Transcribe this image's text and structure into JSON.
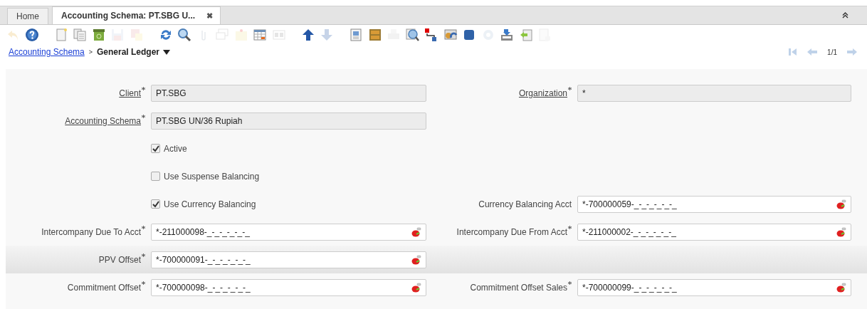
{
  "tabs": [
    {
      "label": "Home",
      "selected": false
    },
    {
      "label": "Accounting Schema: PT.SBG U...",
      "selected": true,
      "close_label": "✖"
    }
  ],
  "toolbar_groups": [
    {
      "buttons": [
        {
          "kind": "undo",
          "disabled": true
        },
        {
          "kind": "help",
          "disabled": false
        }
      ]
    },
    {
      "buttons": [
        {
          "kind": "new",
          "disabled": false
        },
        {
          "kind": "copy",
          "disabled": false
        },
        {
          "kind": "delete",
          "disabled": false
        },
        {
          "kind": "save",
          "disabled": true
        },
        {
          "kind": "savenew",
          "disabled": true
        }
      ]
    },
    {
      "buttons": [
        {
          "kind": "refresh",
          "disabled": false
        },
        {
          "kind": "find",
          "disabled": false
        },
        {
          "kind": "attach",
          "disabled": true
        },
        {
          "kind": "chat",
          "disabled": true
        },
        {
          "kind": "note",
          "disabled": true
        },
        {
          "kind": "grid",
          "disabled": false
        },
        {
          "kind": "multi",
          "disabled": true
        }
      ]
    },
    {
      "buttons": [
        {
          "kind": "up",
          "disabled": false
        },
        {
          "kind": "down",
          "disabled": true
        }
      ]
    },
    {
      "buttons": [
        {
          "kind": "report",
          "disabled": false
        },
        {
          "kind": "archive",
          "disabled": false
        },
        {
          "kind": "print",
          "disabled": true
        },
        {
          "kind": "zoom",
          "disabled": false
        },
        {
          "kind": "export",
          "disabled": false
        },
        {
          "kind": "request",
          "disabled": false
        },
        {
          "kind": "product",
          "disabled": false
        },
        {
          "kind": "process",
          "disabled": true
        },
        {
          "kind": "import",
          "disabled": false
        },
        {
          "kind": "back",
          "disabled": false
        },
        {
          "kind": "custom",
          "disabled": true
        }
      ]
    }
  ],
  "breadcrumb": {
    "link": "Accounting Schema",
    "separator": ">",
    "current": "General Ledger"
  },
  "navigation": {
    "record": "1/1",
    "first_disabled": true,
    "prev_disabled": true,
    "next_disabled": true
  },
  "rows": [
    {
      "highlighted": false,
      "left": {
        "kind": "field",
        "label": "Client",
        "required": true,
        "linked": true,
        "readonly": true,
        "value": "PT.SBG",
        "lookup": false
      },
      "right": {
        "kind": "field",
        "label": "Organization",
        "required": true,
        "linked": true,
        "readonly": true,
        "value": "*",
        "lookup": false
      }
    },
    {
      "highlighted": false,
      "left": {
        "kind": "field",
        "label": "Accounting Schema",
        "required": true,
        "linked": true,
        "readonly": true,
        "value": "PT.SBG UN/36 Rupiah",
        "lookup": false
      }
    },
    {
      "highlighted": false,
      "left": {
        "kind": "checkbox",
        "label": "Active",
        "checked": true
      }
    },
    {
      "highlighted": false,
      "left": {
        "kind": "checkbox",
        "label": "Use Suspense Balancing",
        "checked": false
      }
    },
    {
      "highlighted": false,
      "left": {
        "kind": "checkbox",
        "label": "Use Currency Balancing",
        "checked": true
      },
      "right": {
        "kind": "field",
        "label": "Currency Balancing Acct",
        "required": false,
        "linked": false,
        "readonly": false,
        "value": "*-700000059-_-_-_-_-_-_",
        "lookup": true
      }
    },
    {
      "highlighted": false,
      "left": {
        "kind": "field",
        "label": "Intercompany Due To Acct",
        "required": true,
        "linked": false,
        "readonly": false,
        "value": "*-211000098-_-_-_-_-_-_",
        "lookup": true
      },
      "right": {
        "kind": "field",
        "label": "Intercompany Due From Acct",
        "required": true,
        "linked": false,
        "readonly": false,
        "value": "*-211000002-_-_-_-_-_-_",
        "lookup": true
      }
    },
    {
      "highlighted": true,
      "left": {
        "kind": "field",
        "label": "PPV Offset",
        "required": true,
        "linked": false,
        "readonly": false,
        "value": "*-700000091-_-_-_-_-_-_",
        "lookup": true
      }
    },
    {
      "highlighted": false,
      "left": {
        "kind": "field",
        "label": "Commitment Offset",
        "required": true,
        "linked": false,
        "readonly": false,
        "value": "*-700000098-_-_-_-_-_-_",
        "lookup": true
      },
      "right": {
        "kind": "field",
        "label": "Commitment Offset Sales",
        "required": true,
        "linked": false,
        "readonly": false,
        "value": "*-700000099-_-_-_-_-_-_",
        "lookup": true
      }
    }
  ]
}
